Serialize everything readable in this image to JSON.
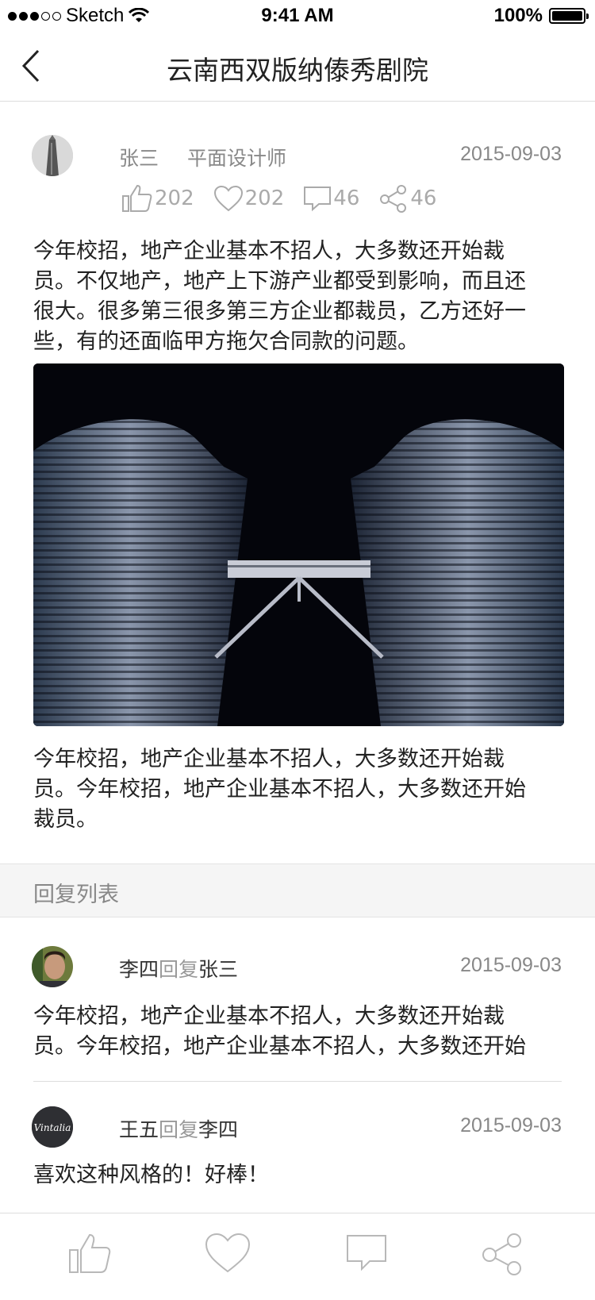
{
  "status_bar": {
    "carrier": "Sketch",
    "time": "9:41 AM",
    "battery": "100%"
  },
  "nav": {
    "title": "云南西双版纳傣秀剧院"
  },
  "post": {
    "author": "张三",
    "role": "平面设计师",
    "date": "2015-09-03",
    "stats": {
      "likes": "202",
      "favorites": "202",
      "comments": "46",
      "shares": "46"
    },
    "text_lines": [
      "今年校招，地产企业基本不招人，大多数还开始裁",
      "员。不仅地产，地产上下游产业都受到影响，而且还",
      "很大。很多第三很多第三方企业都裁员，乙方还好一",
      "些，有的还面临甲方拖欠合同款的问题。"
    ],
    "caption_lines": [
      "今年校招，地产企业基本不招人，大多数还开始裁",
      "员。今年校招，地产企业基本不招人，大多数还开始",
      "裁员。"
    ]
  },
  "reply_section": {
    "title": "回复列表"
  },
  "replies": [
    {
      "from": "李四",
      "verb": "回复",
      "to": "张三",
      "date": "2015-09-03",
      "lines": [
        "今年校招，地产企业基本不招人，大多数还开始裁",
        "员。今年校招，地产企业基本不招人，大多数还开始"
      ]
    },
    {
      "from": "王五",
      "verb": "回复",
      "to": "李四",
      "date": "2015-09-03",
      "avatar_text": "Vintalia",
      "lines": [
        "喜欢这种风格的！好棒！"
      ]
    }
  ],
  "tabbar": {
    "icons": [
      "thumbs-up-icon",
      "heart-icon",
      "comment-icon",
      "share-icon"
    ]
  }
}
